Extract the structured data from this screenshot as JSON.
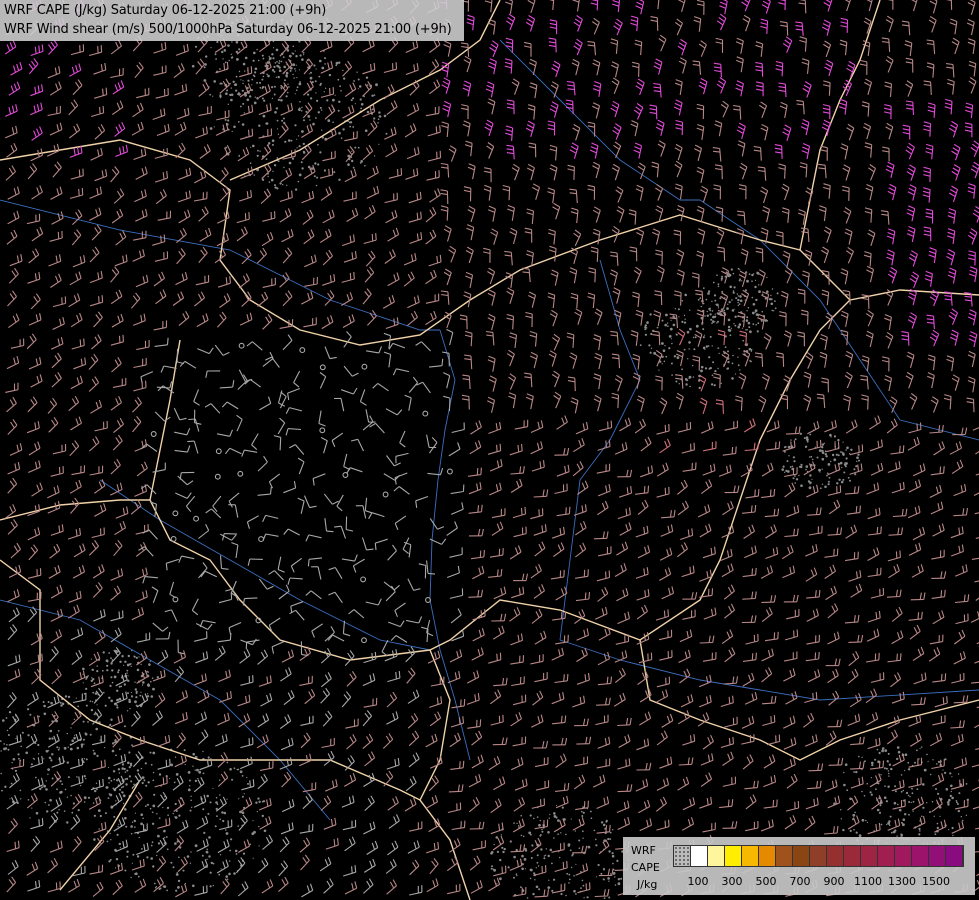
{
  "title": {
    "line1": "WRF CAPE (J/kg) Saturday 06-12-2025 21:00 (+9h)",
    "line2": "WRF Wind shear (m/s) 500/1000hPa Saturday 06-12-2025 21:00 (+9h)"
  },
  "legend": {
    "label_line1": "WRF",
    "label_line2": "CAPE",
    "label_line3": "J/kg",
    "colors": [
      "#bbbbbb",
      "#ffffff",
      "#fff59d",
      "#ffee00",
      "#f6b800",
      "#e58a00",
      "#a0521c",
      "#8b4513",
      "#8f3f27",
      "#96302f",
      "#9a2a3a",
      "#9e2444",
      "#a01f50",
      "#a0195e",
      "#9c136c",
      "#920f78",
      "#880c80"
    ],
    "tick_labels": [
      {
        "text": "100",
        "swatch": 1
      },
      {
        "text": "300",
        "swatch": 3
      },
      {
        "text": "500",
        "swatch": 5
      },
      {
        "text": "700",
        "swatch": 7
      },
      {
        "text": "900",
        "swatch": 9
      },
      {
        "text": "1100",
        "swatch": 11
      },
      {
        "text": "1300",
        "swatch": 13
      },
      {
        "text": "1500",
        "swatch": 15
      }
    ]
  },
  "map_colors": {
    "background": "#000000",
    "country_border": "#f0d2a8",
    "river": "#3b6fbf",
    "terrain": "#8a8a8a",
    "barb_low": "#a8a8a8",
    "barb_mid": "#b88787",
    "barb_high": "#d0707a",
    "barb_strong": "#e24bd8",
    "barb_yellow": "#f2e04a"
  }
}
